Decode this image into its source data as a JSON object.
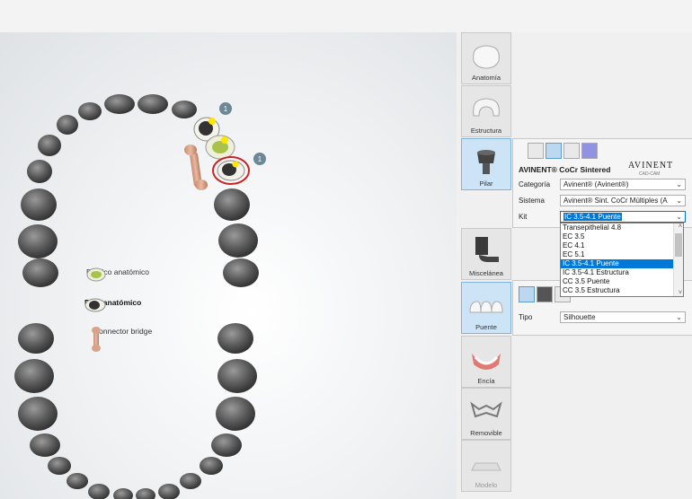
{
  "legend": {
    "pontic": "Póntico anatómico",
    "pilar": "Pilar anatómico",
    "connector": "Connector bridge"
  },
  "badges": {
    "b1": "1",
    "b2": "1"
  },
  "tools": {
    "anatomia": "Anatomía",
    "estructura": "Estructura",
    "pilar": "Pilar",
    "miscelanea": "Miscelánea",
    "puente": "Puente",
    "encia": "Encía",
    "removible": "Removible",
    "modelo": "Modelo"
  },
  "pilar_panel": {
    "material_title": "AVINENT® CoCr Sintered",
    "brand_logo": "AVINENT",
    "brand_sub": "CAD-CAM",
    "categoria_label": "Categoría",
    "categoria_value": "Avinent® (Avinent®)",
    "sistema_label": "Sistema",
    "sistema_value": "Avinent® Sint. CoCr Múltiples (A",
    "kit_label": "Kit",
    "kit_value": "IC 3.5-4.1 Puente"
  },
  "kit_options": [
    "Transepithelial 4.8",
    "EC 3.5",
    "EC 4.1",
    "EC 5.1",
    "IC 3.5-4.1 Puente",
    "IC 3.5-4.1 Estructura",
    "CC 3.5 Puente",
    "CC 3.5 Estructura"
  ],
  "kit_selected_index": 4,
  "puente_panel": {
    "tipo_label": "Tipo",
    "tipo_value": "Silhouette"
  },
  "colors": {
    "accent": "#0078d7",
    "active_tool": "#cde4f7",
    "ring": "#cc2222"
  }
}
